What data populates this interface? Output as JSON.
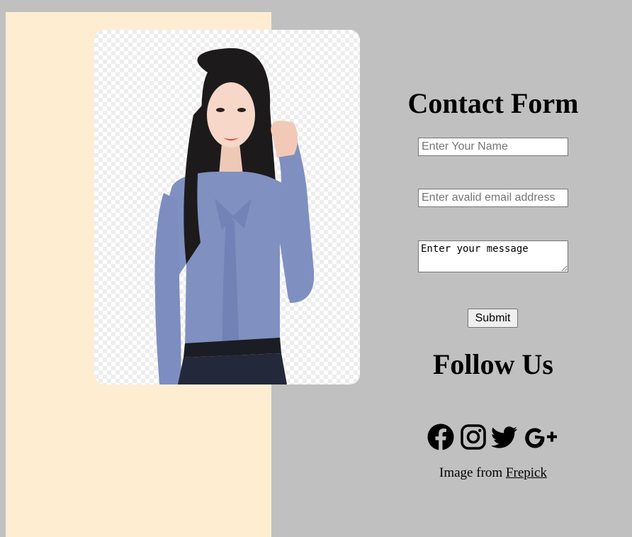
{
  "contact": {
    "title": "Contact Form",
    "name_placeholder": "Enter Your Name",
    "email_placeholder": "Enter avalid email address",
    "message_placeholder": "Enter your message",
    "submit_label": "Submit"
  },
  "follow": {
    "title": "Follow Us",
    "icons": [
      "facebook-icon",
      "instagram-icon",
      "twitter-icon",
      "google-plus-icon"
    ]
  },
  "credit": {
    "prefix": "Image from ",
    "link_text": "Frepick"
  },
  "colors": {
    "page_background": "#c0c0c0",
    "left_panel": "#ffedd2",
    "shirt": "#8090c0",
    "text": "#000000"
  }
}
